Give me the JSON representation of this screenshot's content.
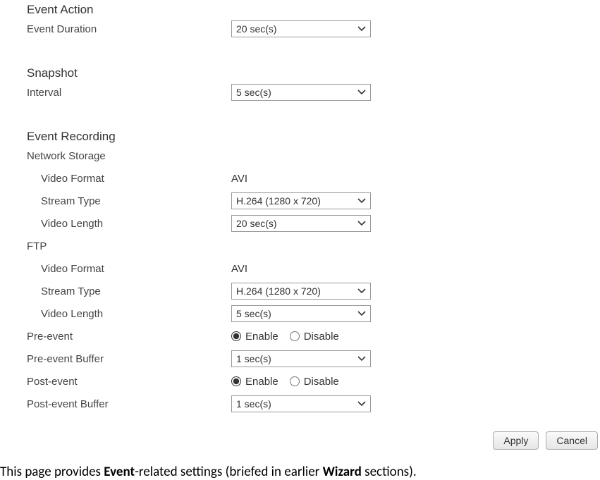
{
  "eventAction": {
    "heading": "Event Action",
    "duration": {
      "label": "Event Duration",
      "value": "20 sec(s)"
    }
  },
  "snapshot": {
    "heading": "Snapshot",
    "interval": {
      "label": "Interval",
      "value": "5 sec(s)"
    }
  },
  "eventRecording": {
    "heading": "Event Recording",
    "networkStorage": {
      "heading": "Network Storage",
      "videoFormat": {
        "label": "Video Format",
        "value": "AVI"
      },
      "streamType": {
        "label": "Stream Type",
        "value": "H.264 (1280 x 720)"
      },
      "videoLength": {
        "label": "Video Length",
        "value": "20 sec(s)"
      }
    },
    "ftp": {
      "heading": "FTP",
      "videoFormat": {
        "label": "Video Format",
        "value": "AVI"
      },
      "streamType": {
        "label": "Stream Type",
        "value": "H.264 (1280 x 720)"
      },
      "videoLength": {
        "label": "Video Length",
        "value": "5 sec(s)"
      }
    },
    "preEvent": {
      "label": "Pre-event",
      "enable": "Enable",
      "disable": "Disable",
      "selected": "enable"
    },
    "preEventBuffer": {
      "label": "Pre-event Buffer",
      "value": "1 sec(s)"
    },
    "postEvent": {
      "label": "Post-event",
      "enable": "Enable",
      "disable": "Disable",
      "selected": "enable"
    },
    "postEventBuffer": {
      "label": "Post-event Buffer",
      "value": "1 sec(s)"
    }
  },
  "buttons": {
    "apply": "Apply",
    "cancel": "Cancel"
  },
  "caption": {
    "prefix": "This page provides ",
    "bold1": "Event",
    "mid": "-related settings (briefed in earlier ",
    "bold2": "Wizard",
    "suffix": " sections)."
  }
}
